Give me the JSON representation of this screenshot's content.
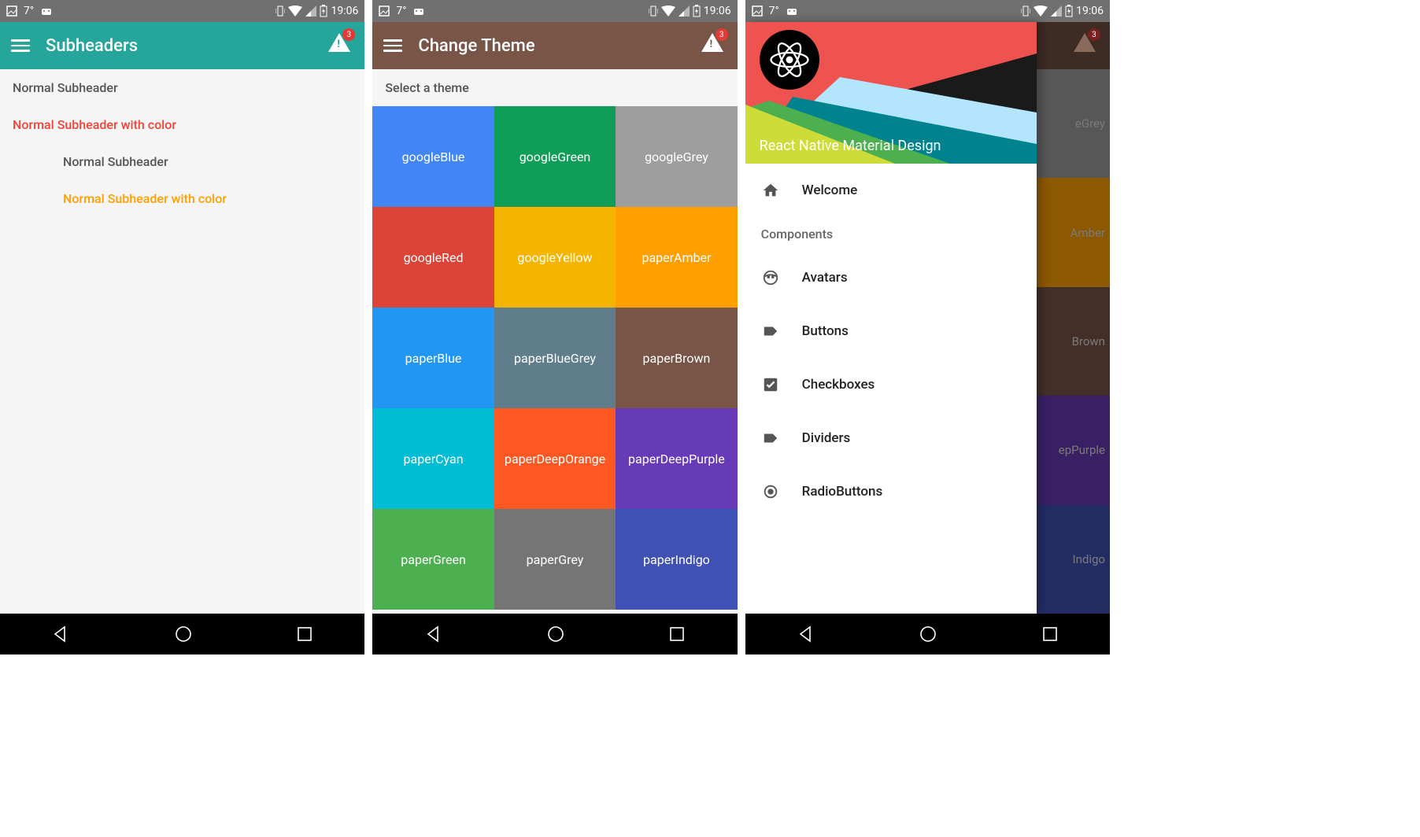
{
  "statusbar": {
    "temp": "7°",
    "time": "19:06"
  },
  "badge_count": "3",
  "phone1": {
    "title": "Subheaders",
    "appbar_color": "#26a69a",
    "items": [
      {
        "label": "Normal Subheader",
        "color": "#555555",
        "inset": false
      },
      {
        "label": "Normal Subheader with color",
        "color": "#f44336",
        "inset": false
      },
      {
        "label": "Normal Subheader",
        "color": "#555555",
        "inset": true
      },
      {
        "label": "Normal Subheader with color",
        "color": "#ffa000",
        "inset": true
      }
    ]
  },
  "phone2": {
    "title": "Change Theme",
    "appbar_color": "#795548",
    "select_label": "Select a theme",
    "themes": [
      {
        "label": "googleBlue",
        "color": "#4285f4"
      },
      {
        "label": "googleGreen",
        "color": "#0f9d58"
      },
      {
        "label": "googleGrey",
        "color": "#9e9e9e"
      },
      {
        "label": "googleRed",
        "color": "#db4437"
      },
      {
        "label": "googleYellow",
        "color": "#f4b400"
      },
      {
        "label": "paperAmber",
        "color": "#ffa000"
      },
      {
        "label": "paperBlue",
        "color": "#2196f3"
      },
      {
        "label": "paperBlueGrey",
        "color": "#607d8b"
      },
      {
        "label": "paperBrown",
        "color": "#795548"
      },
      {
        "label": "paperCyan",
        "color": "#00bcd4"
      },
      {
        "label": "paperDeepOrange",
        "color": "#ff5722"
      },
      {
        "label": "paperDeepPurple",
        "color": "#673ab7"
      },
      {
        "label": "paperGreen",
        "color": "#4caf50"
      },
      {
        "label": "paperGrey",
        "color": "#757575"
      },
      {
        "label": "paperIndigo",
        "color": "#3f51b5"
      }
    ]
  },
  "phone3": {
    "drawer_title": "React Native Material Design",
    "section_label": "Components",
    "items": [
      {
        "label": "Welcome",
        "icon": "home"
      },
      {
        "label": "Avatars",
        "icon": "face"
      },
      {
        "label": "Buttons",
        "icon": "label"
      },
      {
        "label": "Checkboxes",
        "icon": "checkbox"
      },
      {
        "label": "Dividers",
        "icon": "label"
      },
      {
        "label": "RadioButtons",
        "icon": "radio"
      }
    ],
    "bg_themes": [
      {
        "label": "eGrey",
        "color": "#9e9e9e"
      },
      {
        "label": "Amber",
        "color": "#ffa000"
      },
      {
        "label": "Brown",
        "color": "#795548"
      },
      {
        "label": "epPurple",
        "color": "#673ab7"
      },
      {
        "label": "Indigo",
        "color": "#3f51b5"
      }
    ]
  }
}
